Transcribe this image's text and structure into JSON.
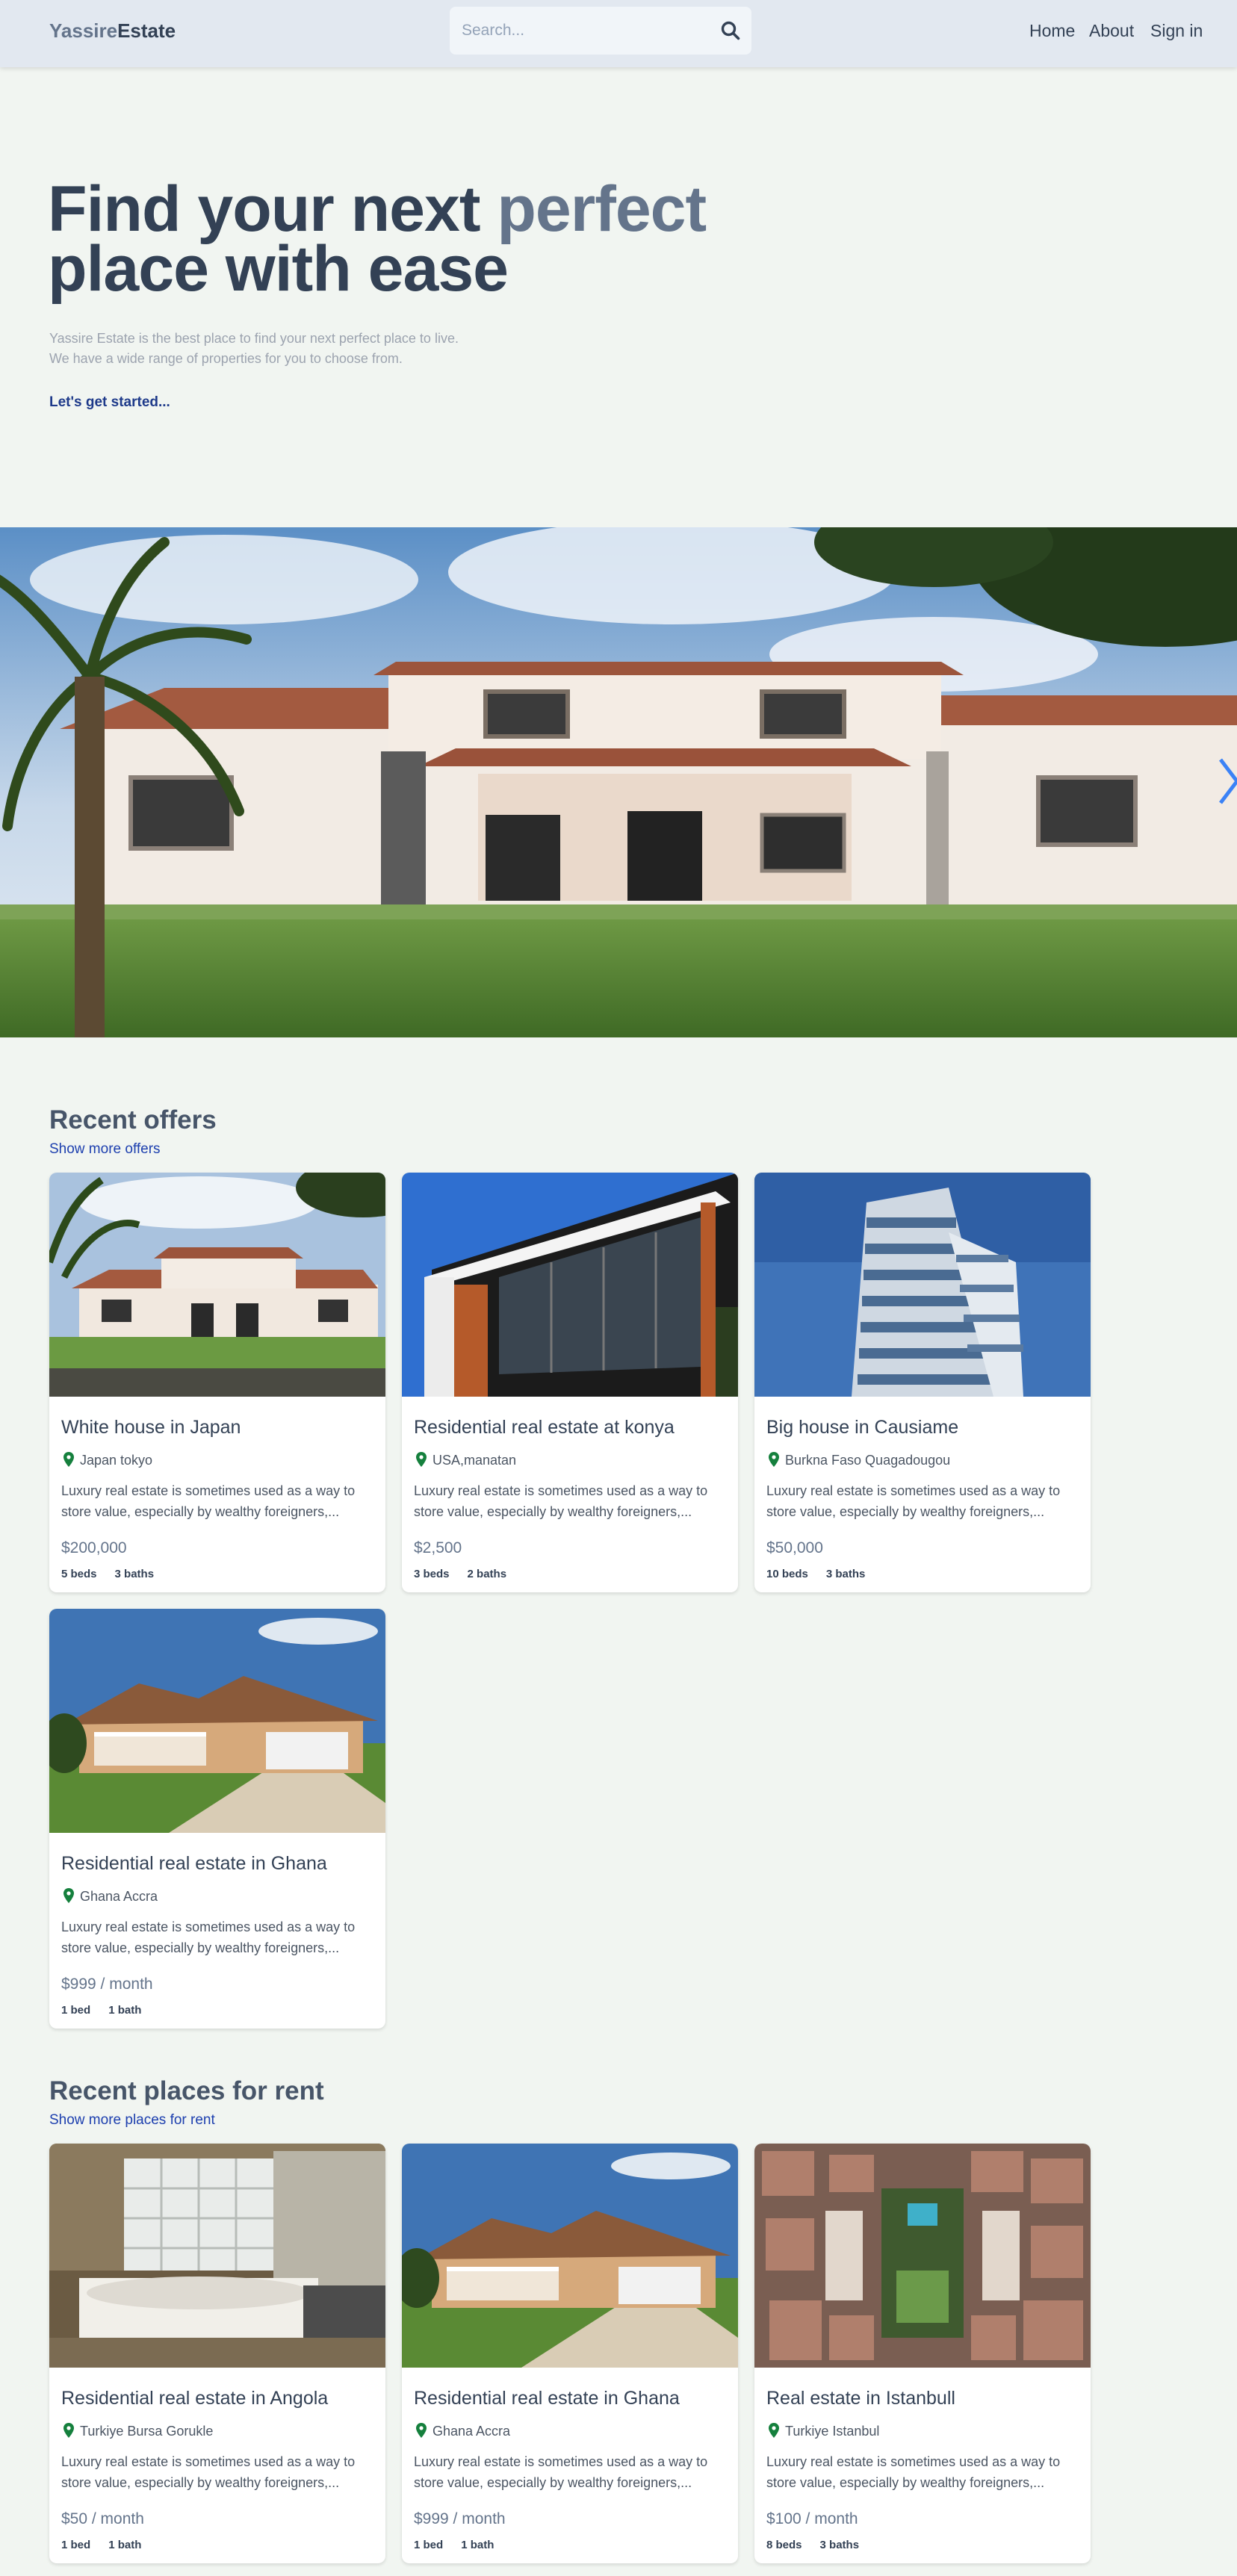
{
  "header": {
    "logo_part1": "Yassire",
    "logo_part2": "Estate",
    "search_placeholder": "Search...",
    "nav": [
      "Home",
      "About",
      "Sign in"
    ]
  },
  "hero": {
    "title_line1_a": "Find your next ",
    "title_line1_b": "perfect",
    "title_line2": "place with ease",
    "subtitle_line1": "Yassire Estate is the best place to find your next perfect place to live.",
    "subtitle_line2": "We have a wide range of properties for you to choose from.",
    "cta": "Let's get started..."
  },
  "offers": {
    "title": "Recent offers",
    "link": "Show more offers",
    "cards": [
      {
        "title": "White house in Japan",
        "location": "Japan tokyo",
        "description": "Luxury real estate is sometimes used as a way to store value, especially by wealthy foreigners,...",
        "price": "$200,000",
        "beds": "5 beds",
        "baths": "3 baths"
      },
      {
        "title": "Residential real estate at konya",
        "location": "USA,manatan",
        "description": "Luxury real estate is sometimes used as a way to store value, especially by wealthy foreigners,...",
        "price": "$2,500",
        "beds": "3 beds",
        "baths": "2 baths"
      },
      {
        "title": "Big house in Causiame",
        "location": "Burkna Faso Quagadougou",
        "description": "Luxury real estate is sometimes used as a way to store value, especially by wealthy foreigners,...",
        "price": "$50,000",
        "beds": "10 beds",
        "baths": "3 baths"
      },
      {
        "title": "Residential real estate in Ghana",
        "location": "Ghana Accra",
        "description": "Luxury real estate is sometimes used as a way to store value, especially by wealthy foreigners,...",
        "price": "$999 / month",
        "beds": "1 bed",
        "baths": "1 bath"
      }
    ]
  },
  "rent": {
    "title": "Recent places for rent",
    "link": "Show more places for rent",
    "cards": [
      {
        "title": "Residential real estate in Angola",
        "location": "Turkiye Bursa Gorukle",
        "description": "Luxury real estate is sometimes used as a way to store value, especially by wealthy foreigners,...",
        "price": "$50 / month",
        "beds": "1 bed",
        "baths": "1 bath"
      },
      {
        "title": "Residential real estate in Ghana",
        "location": "Ghana Accra",
        "description": "Luxury real estate is sometimes used as a way to store value, especially by wealthy foreigners,...",
        "price": "$999 / month",
        "beds": "1 bed",
        "baths": "1 bath"
      },
      {
        "title": "Real estate in Istanbull",
        "location": "Turkiye Istanbul",
        "description": "Luxury real estate is sometimes used as a way to store value, especially by wealthy foreigners,...",
        "price": "$100 / month",
        "beds": "8 beds",
        "baths": "3 baths"
      }
    ]
  },
  "colors": {
    "pin": "#15803d",
    "link": "#1e40af",
    "accent": "#64748b",
    "slider_arrow": "#3b82f6"
  }
}
